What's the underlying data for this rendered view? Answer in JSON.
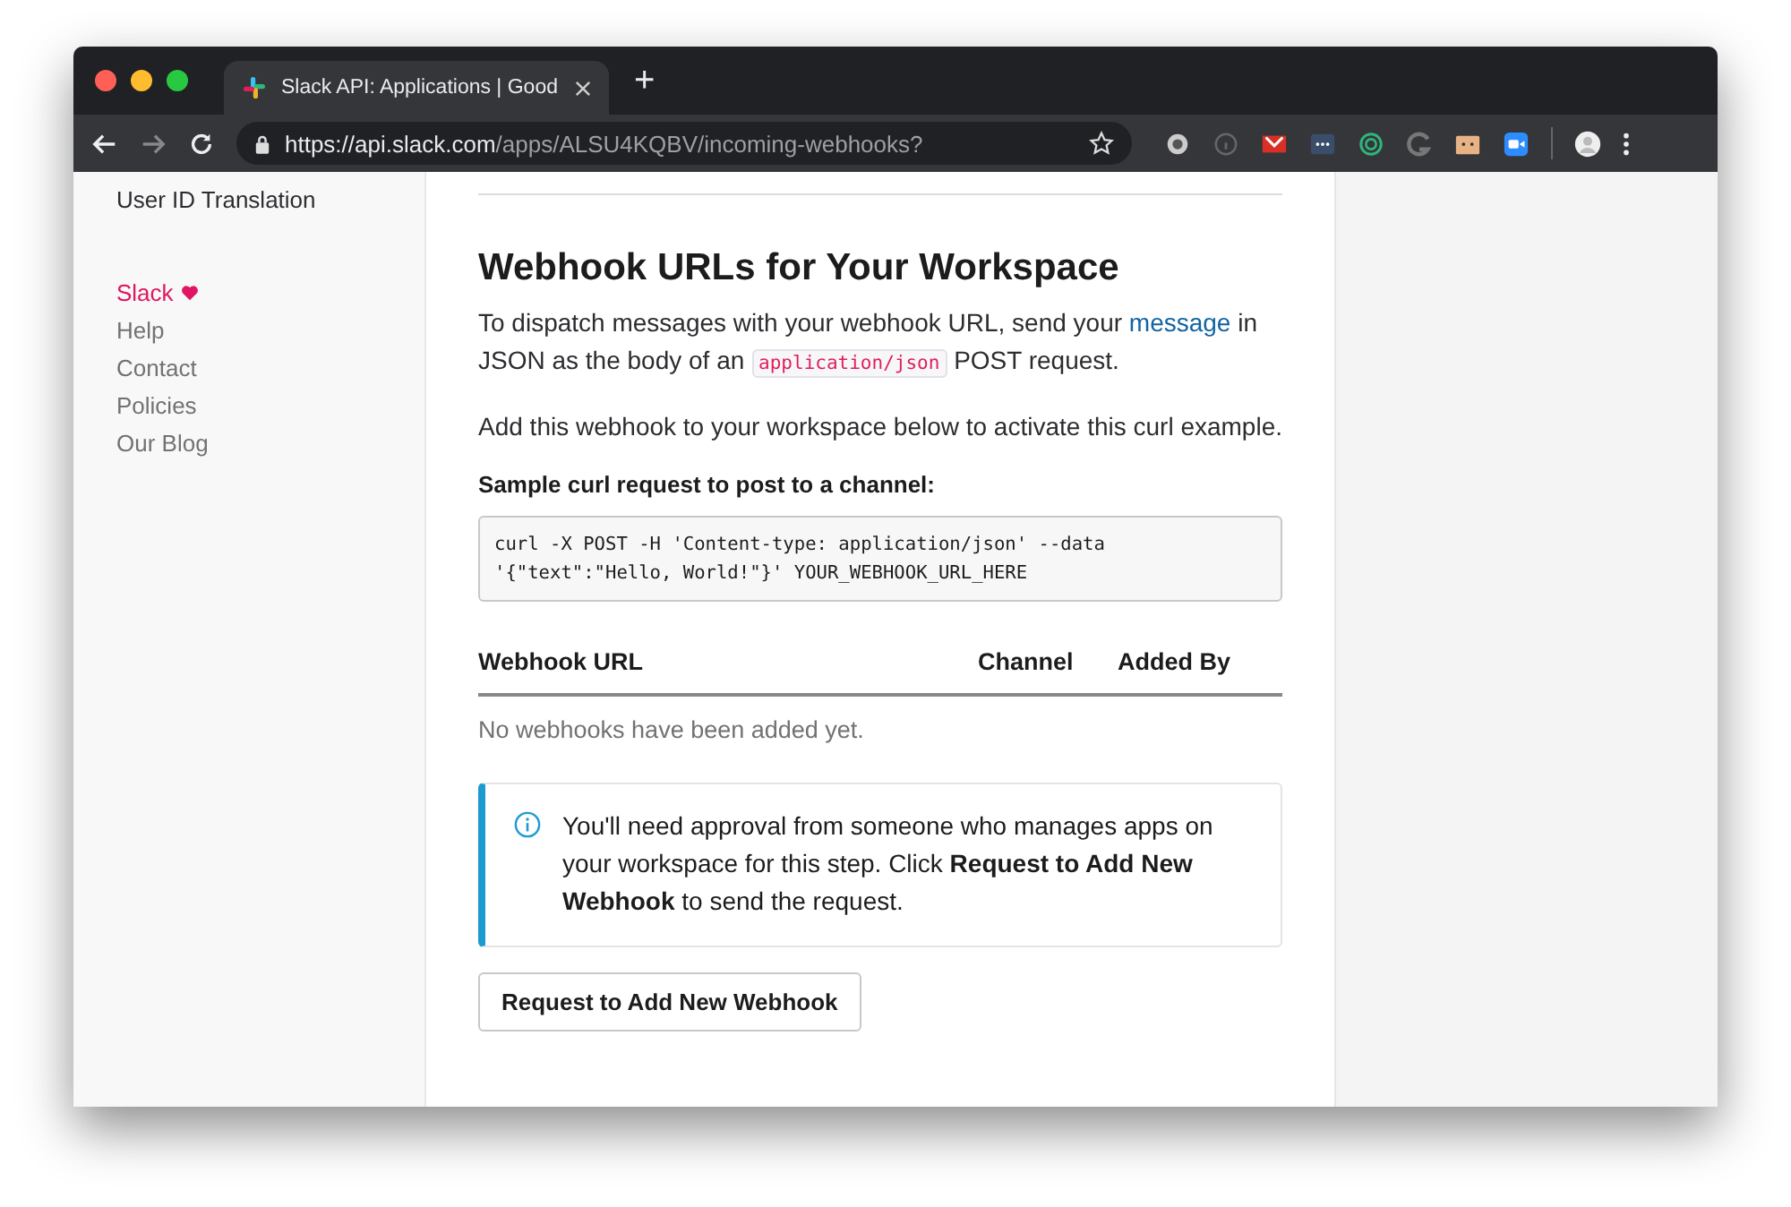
{
  "browser": {
    "tab": {
      "title": "Slack API: Applications | Good",
      "selected": true
    },
    "new_tab": "+",
    "url_host": "https://api.slack.com",
    "url_path": "/apps/ALSU4KQBV/incoming-webhooks?"
  },
  "sidebar": {
    "top_item": "User ID Translation",
    "items": [
      {
        "label": "Slack",
        "kind": "brand"
      },
      {
        "label": "Help",
        "kind": "link"
      },
      {
        "label": "Contact",
        "kind": "link"
      },
      {
        "label": "Policies",
        "kind": "link"
      },
      {
        "label": "Our Blog",
        "kind": "link"
      }
    ]
  },
  "main": {
    "heading": "Webhook URLs for Your Workspace",
    "intro": [
      {
        "kind": "text",
        "text": "To dispatch messages with your webhook URL, send your "
      },
      {
        "kind": "link",
        "text": "message"
      },
      {
        "kind": "text",
        "text": " in JSON as the body of an "
      },
      {
        "kind": "code",
        "text": "application/json"
      },
      {
        "kind": "text",
        "text": " POST request."
      }
    ],
    "note": "Add this webhook to your workspace below to activate this curl example.",
    "sample_label": "Sample curl request to post to a channel:",
    "code_lines": [
      "curl -X POST -H 'Content-type: application/json' --data",
      "'{\"text\":\"Hello, World!\"}' YOUR_WEBHOOK_URL_HERE"
    ],
    "table": {
      "columns": [
        "Webhook URL",
        "Channel",
        "Added By"
      ],
      "empty": "No webhooks have been added yet."
    },
    "info": "You'll need approval from someone who manages apps on your workspace for this step. Click **Request to Add New Webhook** to send the request.",
    "button": "Request to Add New Webhook"
  }
}
